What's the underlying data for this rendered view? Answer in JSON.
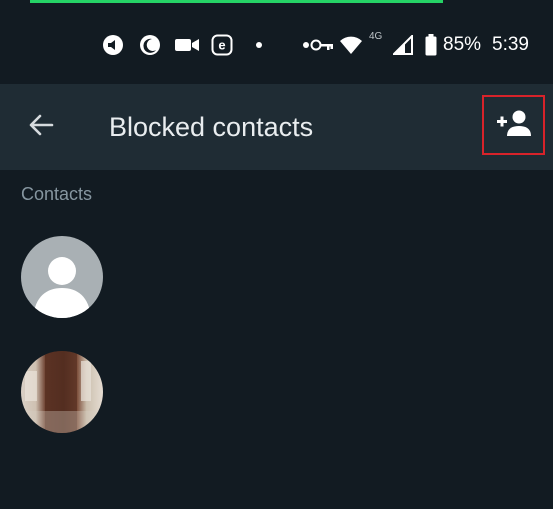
{
  "status_bar": {
    "battery": "85%",
    "time": "5:39",
    "network": "4G",
    "icons": [
      "volume-icon",
      "moon-icon",
      "video-icon",
      "e-app-icon",
      "dot-icon",
      "dot-icon",
      "key-icon",
      "wifi-icon",
      "cell-signal-icon",
      "battery-icon"
    ]
  },
  "app_bar": {
    "title": "Blocked contacts",
    "back_icon": "arrow-left-icon",
    "add_icon": "add-person-icon"
  },
  "section": {
    "label": "Contacts"
  },
  "contacts": [
    {
      "avatar": "default-avatar"
    },
    {
      "avatar": "photo-avatar"
    }
  ],
  "colors": {
    "background": "#121b22",
    "app_bar": "#1f2c34",
    "accent_green": "#25d366",
    "highlight_red": "#d8232a",
    "section_text": "#8696a0"
  }
}
